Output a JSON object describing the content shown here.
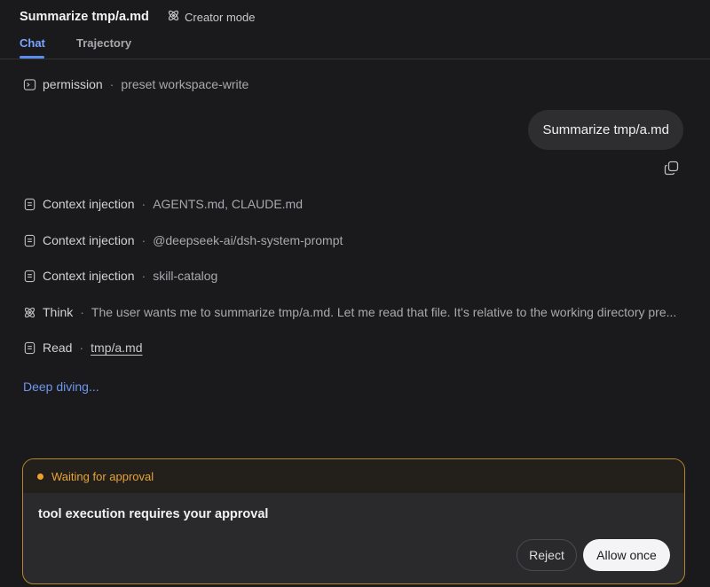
{
  "header": {
    "title": "Summarize tmp/a.md",
    "mode_label": "Creator mode",
    "tabs": [
      {
        "label": "Chat",
        "active": true
      },
      {
        "label": "Trajectory",
        "active": false
      }
    ]
  },
  "permission": {
    "label": "permission",
    "detail": "preset workspace-write",
    "icon": "terminal-icon"
  },
  "user_message": "Summarize tmp/a.md",
  "steps": [
    {
      "label": "Context injection",
      "detail": "AGENTS.md, CLAUDE.md",
      "icon": "document-icon"
    },
    {
      "label": "Context injection",
      "detail": "@deepseek-ai/dsh-system-prompt",
      "icon": "document-icon"
    },
    {
      "label": "Context injection",
      "detail": "skill-catalog",
      "icon": "document-icon"
    },
    {
      "label": "Think",
      "detail": "The user wants me to summarize tmp/a.md. Let me read that file. It's relative to the working directory pre...",
      "icon": "atom-icon"
    },
    {
      "label": "Read",
      "detail": "tmp/a.md",
      "icon": "document-icon"
    }
  ],
  "status_text": "Deep diving...",
  "approval": {
    "status": "Waiting for approval",
    "message": "tool execution requires your approval",
    "reject_label": "Reject",
    "allow_label": "Allow once"
  },
  "colors": {
    "background": "#1a1a1c",
    "accent": "#5b8def",
    "warning": "#f0a02a"
  }
}
